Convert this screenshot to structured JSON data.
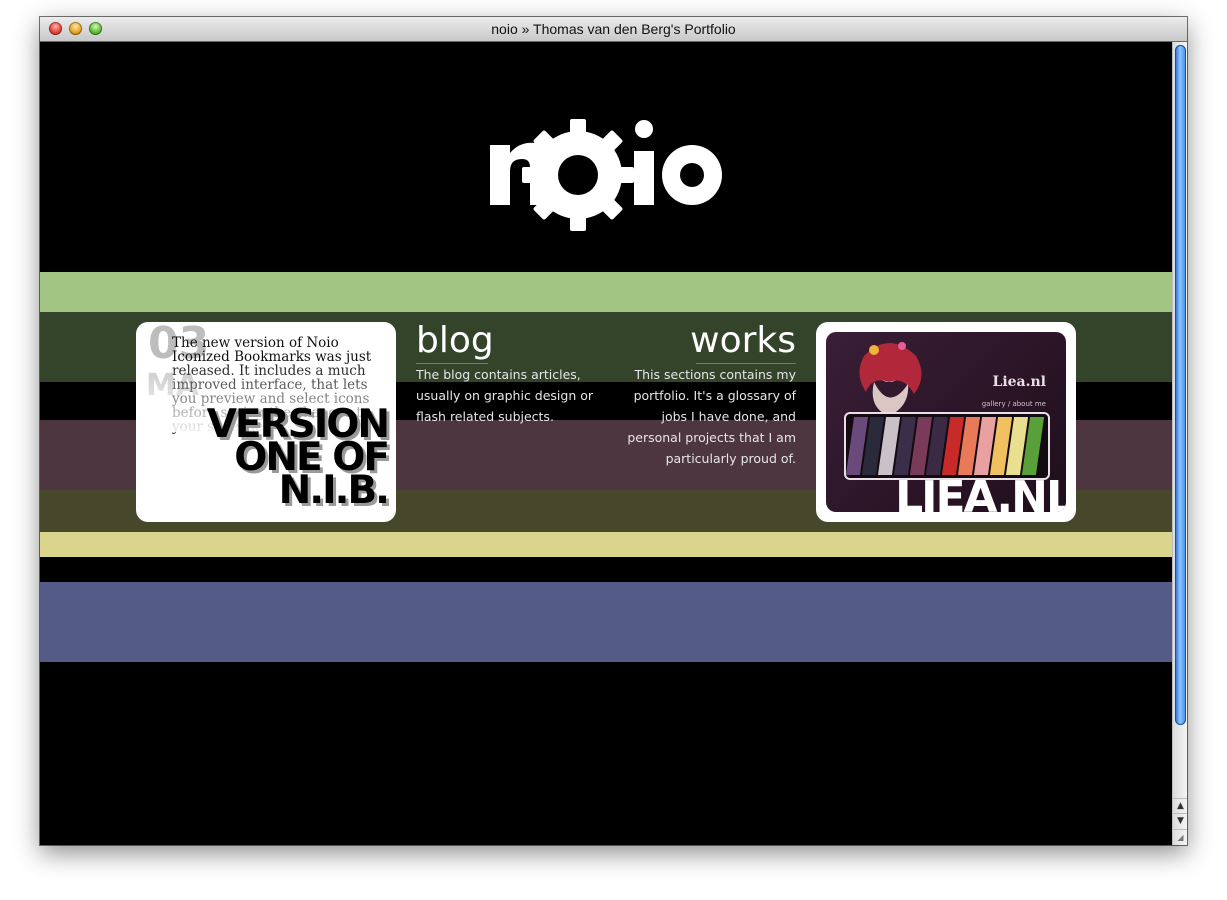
{
  "window": {
    "title": "noio » Thomas van den Berg's Portfolio"
  },
  "header": {
    "logo_text": "noio"
  },
  "colors": {
    "stripe_green": "#a3c584",
    "stripe_darkgreen": "#33442a",
    "stripe_plum": "#4d3640",
    "stripe_olive": "#47472c",
    "stripe_yellow": "#dad48d",
    "stripe_blue": "#555b87",
    "scroll_thumb": "#3b8af0"
  },
  "news": {
    "date_day": "03",
    "date_month": "MA",
    "text": "The new version of Noio Iconized Bookmarks was just released. It includes a much improved interface, that lets you preview and select icons before saving the changes to your stylesheet.",
    "big_line1": "VERSION",
    "big_line2": "ONE OF",
    "big_line3": "N.I.B."
  },
  "blog": {
    "heading": "blog",
    "description": "The blog contains articles, usually on graphic design or flash related subjects."
  },
  "works": {
    "heading": "works",
    "description": "This sections contains my portfolio. It's a glossary of jobs I have done, and personal projects that I am particularly proud of.",
    "thumbnail_site": "Liea.nl",
    "thumbnail_nav": "gallery / about me",
    "thumbnail_big": "LIEA.NL"
  },
  "icons": {
    "close": "close-light-icon",
    "minimize": "minimize-light-icon",
    "zoom": "zoom-light-icon",
    "gear": "gear-icon",
    "scroll_up": "arrow-up-icon",
    "scroll_down": "arrow-down-icon",
    "resize": "resize-grip-icon"
  }
}
